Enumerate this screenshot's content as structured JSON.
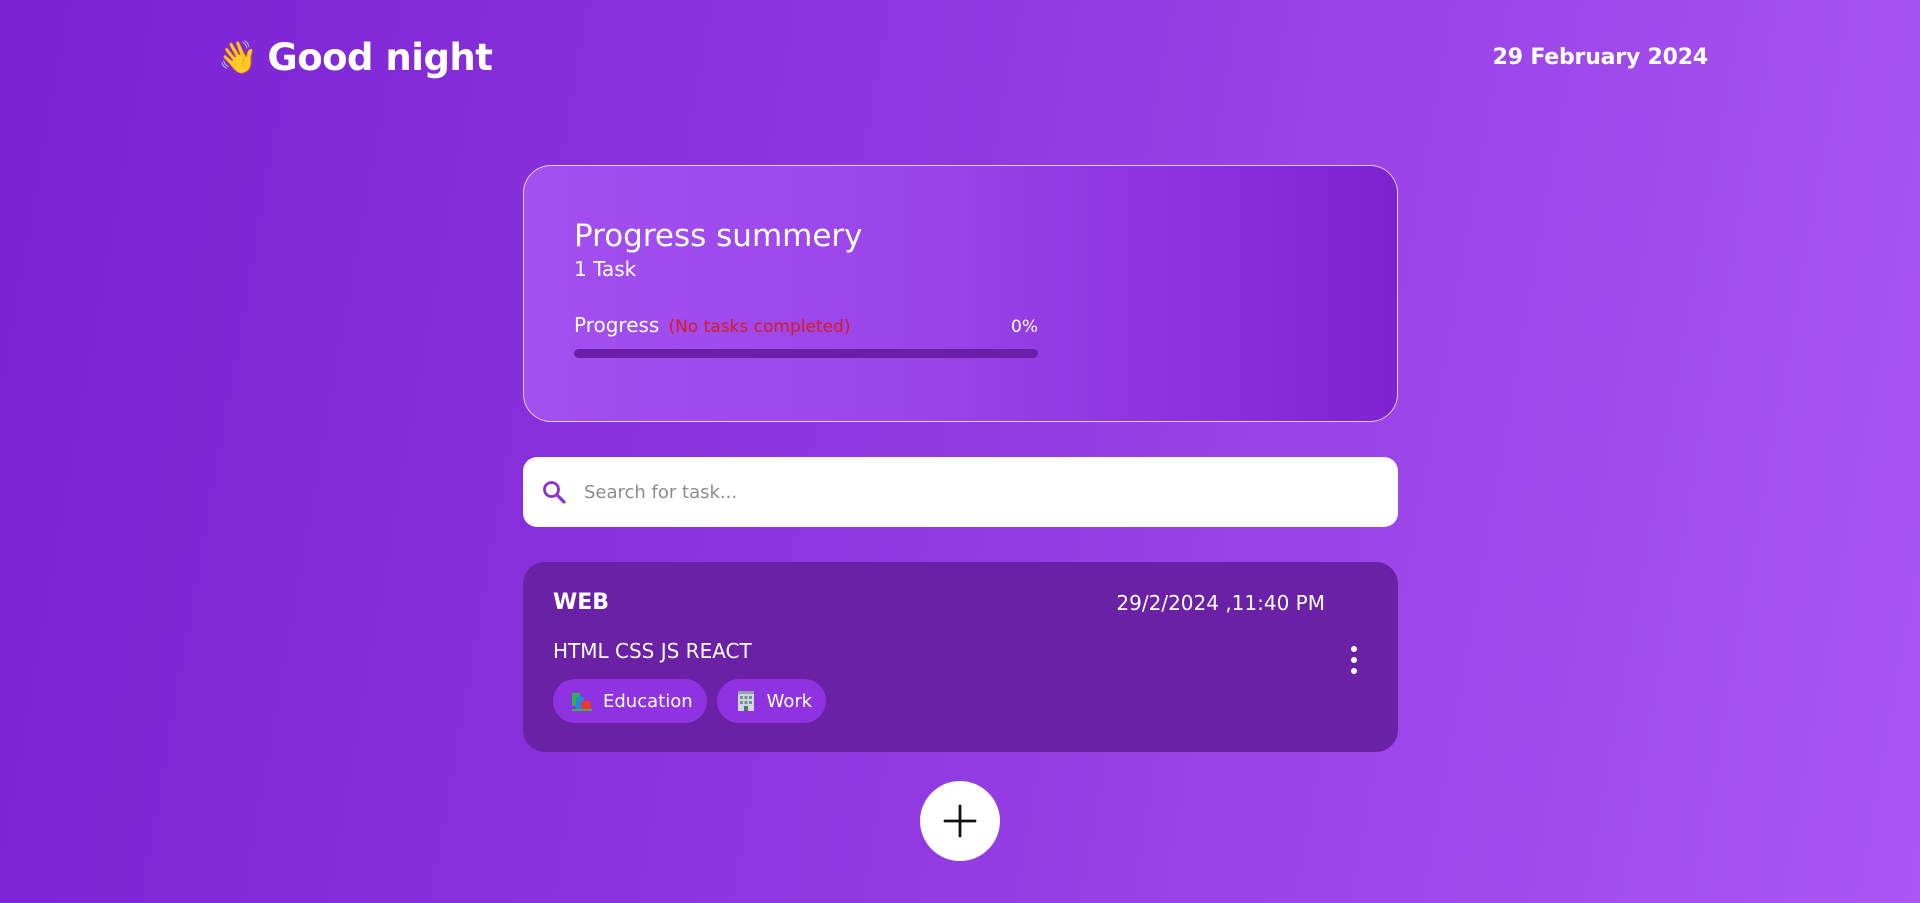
{
  "header": {
    "wave_emoji": "👋",
    "greeting": "Good night",
    "date": "29 February 2024"
  },
  "summary": {
    "title": "Progress summery",
    "task_count": "1 Task",
    "progress_label": "Progress",
    "progress_note": "(No tasks completed)",
    "progress_value": "0%",
    "progress_fraction": 0
  },
  "search": {
    "placeholder": "Search for task..."
  },
  "tasks": [
    {
      "title": "WEB",
      "datetime": "29/2/2024 ,11:40 PM",
      "description": "HTML CSS JS REACT",
      "tags": [
        {
          "label": "Education",
          "icon": "books-icon"
        },
        {
          "label": "Work",
          "icon": "office-building-icon"
        }
      ]
    }
  ],
  "colors": {
    "accent": "#8f33e2",
    "card_dark": "#6a21a6",
    "warning": "#d81b1b"
  }
}
